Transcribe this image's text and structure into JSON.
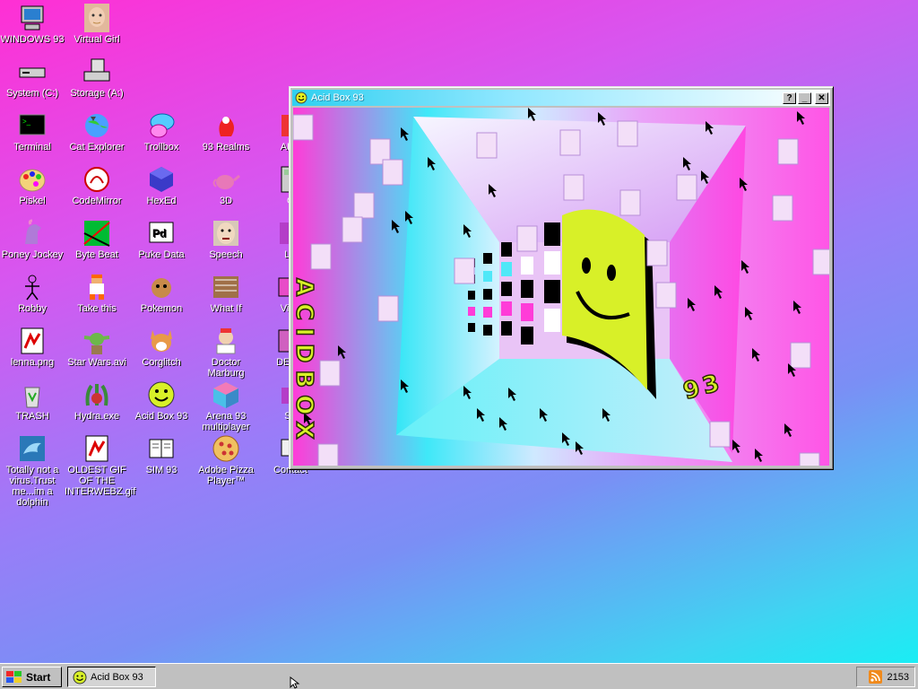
{
  "desktop": {
    "icons": [
      {
        "id": "windows93",
        "label": "WINDOWS 93",
        "icon": "computer-icon"
      },
      {
        "id": "virtual-girl",
        "label": "Virtual Girl",
        "icon": "girl-face-icon"
      },
      {
        "id": "system-c",
        "label": "System (C:)",
        "icon": "hard-drive-icon"
      },
      {
        "id": "storage-a",
        "label": "Storage (A:)",
        "icon": "floppy-drive-icon"
      },
      {
        "id": "terminal",
        "label": "Terminal",
        "icon": "terminal-icon"
      },
      {
        "id": "cat-explorer",
        "label": "Cat Explorer",
        "icon": "globe-cat-icon"
      },
      {
        "id": "trollbox",
        "label": "Trollbox",
        "icon": "chat-bubble-icon"
      },
      {
        "id": "93realms",
        "label": "93 Realms",
        "icon": "realms-icon"
      },
      {
        "id": "ahs",
        "label": "AHS",
        "icon": "ahs-icon"
      },
      {
        "id": "piskel",
        "label": "Piskel",
        "icon": "palette-icon"
      },
      {
        "id": "codemirror",
        "label": "CodeMirror",
        "icon": "codemirror-icon"
      },
      {
        "id": "hexed",
        "label": "HexEd",
        "icon": "hex-cube-icon"
      },
      {
        "id": "3d",
        "label": "3D",
        "icon": "teapot-icon"
      },
      {
        "id": "c",
        "label": "C",
        "icon": "calc-icon"
      },
      {
        "id": "poney-jockey",
        "label": "Poney Jockey",
        "icon": "pony-icon"
      },
      {
        "id": "byte-beat",
        "label": "Byte Beat",
        "icon": "byte-beat-icon"
      },
      {
        "id": "puke-data",
        "label": "Puke Data",
        "icon": "pd-icon"
      },
      {
        "id": "speech",
        "label": "Speech",
        "icon": "speech-face-icon"
      },
      {
        "id": "ls",
        "label": "LS",
        "icon": "ls-icon"
      },
      {
        "id": "robby",
        "label": "Robby",
        "icon": "stick-figure-icon"
      },
      {
        "id": "take-this",
        "label": "Take this",
        "icon": "pixel-guy-icon"
      },
      {
        "id": "pokemon",
        "label": "Pokemon",
        "icon": "pokemon-icon"
      },
      {
        "id": "what-if",
        "label": "What If",
        "icon": "what-if-icon"
      },
      {
        "id": "virtual",
        "label": "Virtu",
        "icon": "virtual-icon"
      },
      {
        "id": "lenna",
        "label": "lenna.png",
        "icon": "image-file-icon"
      },
      {
        "id": "star-wars",
        "label": "Star Wars.avi",
        "icon": "yoda-icon"
      },
      {
        "id": "corglitch",
        "label": "Corglitch",
        "icon": "corgi-icon"
      },
      {
        "id": "doctor-marburg",
        "label": "Doctor Marburg",
        "icon": "doctor-icon"
      },
      {
        "id": "derg",
        "label": "DERG",
        "icon": "derg-icon"
      },
      {
        "id": "trash",
        "label": "TRASH",
        "icon": "recycle-bin-icon"
      },
      {
        "id": "hydra",
        "label": "Hydra.exe",
        "icon": "hydra-icon"
      },
      {
        "id": "acid-box",
        "label": "Acid Box 93",
        "icon": "smiley-icon"
      },
      {
        "id": "arena93",
        "label": "Arena 93 multiplayer",
        "icon": "cube-icon"
      },
      {
        "id": "sl",
        "label": "SL",
        "icon": "sl-icon"
      },
      {
        "id": "dolphin",
        "label": "Totally not a virus.Trust me...im a dolphin",
        "icon": "dolphin-icon"
      },
      {
        "id": "oldest-gif",
        "label": "OLDEST GIF OF THE INTERWEBZ.gif",
        "icon": "image-file-icon"
      },
      {
        "id": "sim93",
        "label": "SIM 93",
        "icon": "book-icon"
      },
      {
        "id": "adobe-pizza",
        "label": "Adobe Pizza Player™",
        "icon": "pizza-icon"
      },
      {
        "id": "contact",
        "label": "Contact",
        "icon": "contact-icon"
      }
    ]
  },
  "window": {
    "title": "Acid Box 93",
    "help_btn": "?",
    "minimize_btn": "_",
    "close_btn": "✕",
    "scene_text_left": "ACIDBOX",
    "scene_text_right": "93"
  },
  "taskbar": {
    "start_label": "Start",
    "task_label": "Acid Box 93",
    "clock": "2153"
  },
  "colors": {
    "desktop_top": "#ff2fd4",
    "desktop_bottom": "#10f4f4",
    "titlebar": "#2fd0f0",
    "smiley": "#d8f028",
    "chrome": "#c0c0c0"
  }
}
